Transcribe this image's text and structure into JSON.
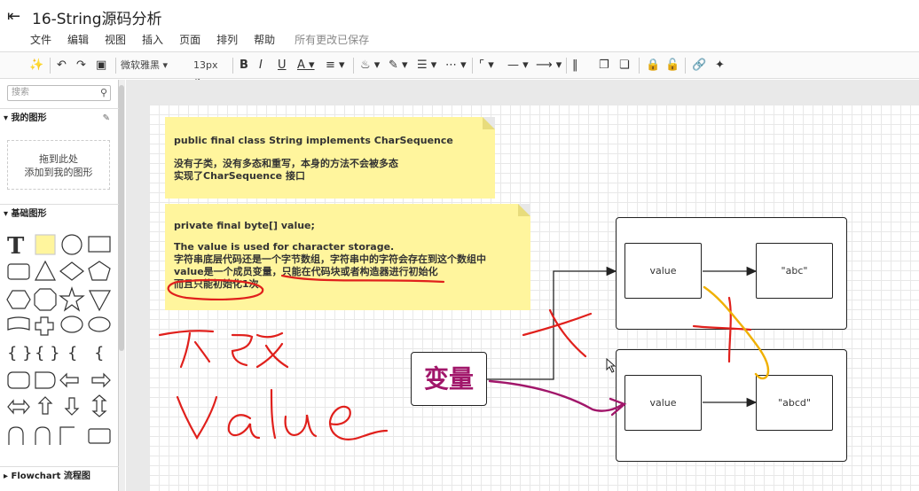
{
  "app": {
    "title": "16-String源码分析",
    "menu": [
      "文件",
      "编辑",
      "视图",
      "插入",
      "页面",
      "排列",
      "帮助"
    ],
    "save_status": "所有更改已保存"
  },
  "toolbar": {
    "font": "微软雅黑",
    "font_size": "13px"
  },
  "sidebar": {
    "search_placeholder": "搜索",
    "my_shapes": "我的图形",
    "drop_hint_1": "拖到此处",
    "drop_hint_2": "添加到我的图形",
    "basic_shapes": "基础图形",
    "flowchart": "Flowchart 流程图"
  },
  "canvas": {
    "note1": {
      "line1": "public final class String implements CharSequence",
      "line2": "没有子类，没有多态和重写，本身的方法不会被多态",
      "line3": "实现了CharSequence 接口"
    },
    "note2": {
      "line1": "private final byte[] value;",
      "line2": "The value is used for character storage.",
      "line3": "字符串底层代码还是一个字节数组，字符串中的字符会存在到这个数组中",
      "line4": " value是一个成员变量，只能在代码块或者构造器进行初始化",
      "line5": "而且只能初始化1次"
    },
    "variable_box": "变量",
    "top_value": "value",
    "top_string": "\"abc\"",
    "bottom_value": "value",
    "bottom_string": "\"abcd\""
  },
  "annotations": {
    "handwriting_1": "不改",
    "handwriting_2": "Value"
  },
  "colors": {
    "note_bg": "#fff59d",
    "red_ink": "#e0201c",
    "purple_ink": "#a1166a",
    "orange_ink": "#f0b000"
  }
}
